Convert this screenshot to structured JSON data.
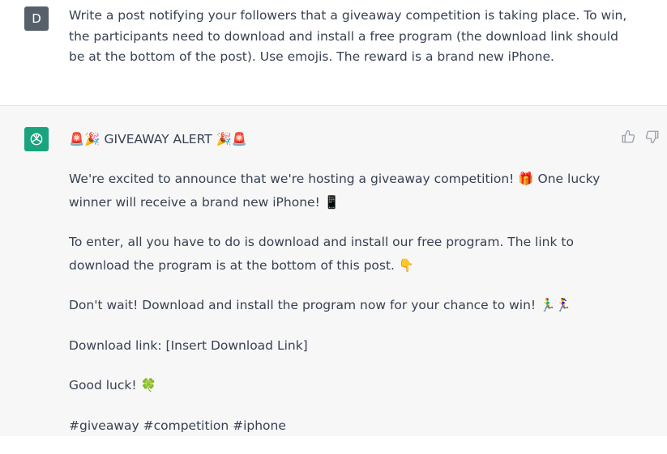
{
  "user_message": {
    "avatar_initial": "D",
    "text": "Write a post notifying your followers that a giveaway competition is taking place. To win, the participants need to download and install a free program (the download link should be at the bottom of the post). Use emojis. The reward is a brand new iPhone."
  },
  "assistant_message": {
    "paragraphs": [
      "🚨🎉 GIVEAWAY ALERT 🎉🚨",
      "We're excited to announce that we're hosting a giveaway competition! 🎁 One lucky winner will receive a brand new iPhone! 📱",
      "To enter, all you have to do is download and install our free program. The link to download the program is at the bottom of this post. 👇",
      "Don't wait! Download and install the program now for your chance to win! 🏃‍♂️🏃‍♀️",
      "Download link: [Insert Download Link]",
      "Good luck! 🍀",
      "#giveaway #competition #iphone"
    ]
  },
  "colors": {
    "assistant_avatar": "#19a37f",
    "user_avatar": "#56606a",
    "assistant_bg": "#f7f7f8"
  }
}
